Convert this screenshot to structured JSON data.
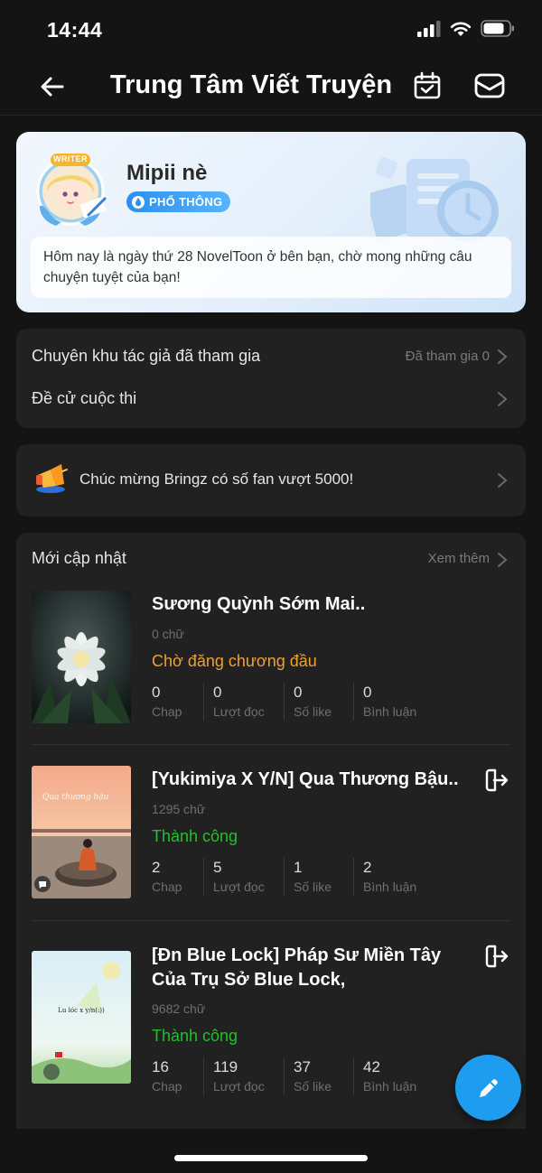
{
  "status": {
    "time": "14:44"
  },
  "nav": {
    "title": "Trung Tâm Viết Truyện",
    "back_icon": "arrow-left-icon",
    "calendar_icon": "calendar-check-icon",
    "mail_icon": "mail-icon"
  },
  "profile": {
    "name": "Mipii nè",
    "avatar_badge": "WRITER",
    "tier": "PHỔ THÔNG",
    "greeting": "Hôm nay là ngày thứ 28 NovelToon ở bên bạn, chờ mong những câu chuyện tuyệt của bạn!"
  },
  "menu": {
    "items": [
      {
        "label": "Chuyên khu tác giả đã tham gia",
        "right": "Đã tham gia 0"
      },
      {
        "label": "Đề cử cuộc thi",
        "right": ""
      }
    ]
  },
  "announcement": {
    "text": "Chúc mừng Bringz có số fan vượt 5000!"
  },
  "updates": {
    "title": "Mới cập nhật",
    "see_more": "Xem thêm",
    "books": [
      {
        "title": "Sương Quỳnh Sớm Mai..",
        "words": "0 chữ",
        "status": "Chờ đăng chương đầu",
        "status_color": "#f0a030",
        "stats": [
          {
            "num": "0",
            "label": "Chap"
          },
          {
            "num": "0",
            "label": "Lượt đọc"
          },
          {
            "num": "0",
            "label": "Số like"
          },
          {
            "num": "0",
            "label": "Bình luận"
          }
        ]
      },
      {
        "title": "[Yukimiya X Y/N] Qua Thương Bậu..",
        "words": "1295 chữ",
        "status": "Thành công",
        "status_color": "#22c02a",
        "cover_text": "Qua thương bậu",
        "stats": [
          {
            "num": "2",
            "label": "Chap"
          },
          {
            "num": "5",
            "label": "Lượt đọc"
          },
          {
            "num": "1",
            "label": "Số like"
          },
          {
            "num": "2",
            "label": "Bình luận"
          }
        ]
      },
      {
        "title": "[Đn Blue Lock] Pháp Sư Miền Tây Của Trụ Sở Blue Lock,",
        "words": "9682 chữ",
        "status": "Thành công",
        "status_color": "#22c02a",
        "cover_text": "Lu lóc x y/n(:))",
        "stats": [
          {
            "num": "16",
            "label": "Chap"
          },
          {
            "num": "119",
            "label": "Lượt đọc"
          },
          {
            "num": "37",
            "label": "Số like"
          },
          {
            "num": "42",
            "label": "Bình luận"
          }
        ]
      }
    ]
  },
  "fab_icon": "pencil-icon"
}
